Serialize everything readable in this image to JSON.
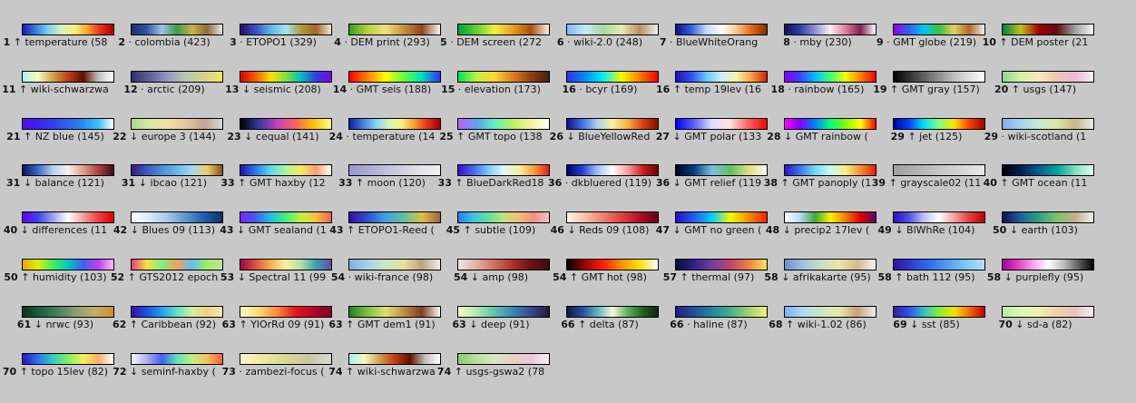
{
  "palettes": [
    {
      "rank": "1",
      "dir": "↑",
      "name": "temperature (58",
      "colors": [
        "#1a1ab0",
        "#3b7bd8",
        "#7ed0f0",
        "#d8f0c0",
        "#f8f080",
        "#f8a030",
        "#e83020",
        "#a00000"
      ]
    },
    {
      "rank": "2",
      "dir": "·",
      "name": "colombia (423)",
      "colors": [
        "#1d2d6b",
        "#2f57a5",
        "#9fc3e7",
        "#3c9a4a",
        "#c8b24a",
        "#8b6a3a",
        "#e8e8e8"
      ]
    },
    {
      "rank": "3",
      "dir": "·",
      "name": "ETOPO1 (329)",
      "colors": [
        "#2a0a6b",
        "#3c4fc4",
        "#5fb6e6",
        "#a6e3f2",
        "#b09a3c",
        "#a06628",
        "#f0e8d8"
      ]
    },
    {
      "rank": "4",
      "dir": "·",
      "name": "DEM print (293)",
      "colors": [
        "#34a020",
        "#b8d040",
        "#f0e080",
        "#c89040",
        "#904818",
        "#f8f8f8"
      ]
    },
    {
      "rank": "5",
      "dir": "·",
      "name": "DEM screen (272",
      "colors": [
        "#00a040",
        "#60d030",
        "#f0f040",
        "#e8a020",
        "#a85010",
        "#f8f0f0"
      ]
    },
    {
      "rank": "6",
      "dir": "·",
      "name": "wiki-2.0 (248)",
      "colors": [
        "#80b8f0",
        "#c8e8f8",
        "#a8d8a0",
        "#e8e8b0",
        "#b89060",
        "#f0f0f0"
      ]
    },
    {
      "rank": "7",
      "dir": "·",
      "name": "BlueWhiteOrang",
      "colors": [
        "#101080",
        "#3060e0",
        "#c0d8f8",
        "#ffffff",
        "#f8c890",
        "#e86818",
        "#803000"
      ]
    },
    {
      "rank": "8",
      "dir": "·",
      "name": "mby (230)",
      "colors": [
        "#101060",
        "#3040a0",
        "#9090d8",
        "#f8f0f0",
        "#e080a0",
        "#802050",
        "#ffffff"
      ]
    },
    {
      "rank": "9",
      "dir": "·",
      "name": "GMT globe (219)",
      "colors": [
        "#9000e0",
        "#3060f0",
        "#00c8f0",
        "#40c040",
        "#e0d060",
        "#b06830",
        "#f0f0f0"
      ]
    },
    {
      "rank": "10",
      "dir": "↑",
      "name": "DEM poster (21",
      "colors": [
        "#008040",
        "#c0c020",
        "#a00000",
        "#601010",
        "#a0a0a0",
        "#f8f8f8"
      ]
    },
    {
      "rank": "11",
      "dir": "↑",
      "name": "wiki-schwarzwa",
      "colors": [
        "#a8f0f0",
        "#f8f8c0",
        "#d0a050",
        "#c04010",
        "#601000",
        "#c0c0c0",
        "#ffffff"
      ]
    },
    {
      "rank": "12",
      "dir": "·",
      "name": "arctic (209)",
      "colors": [
        "#303070",
        "#606098",
        "#9898c0",
        "#b8c8b0",
        "#d8d090",
        "#f0e860"
      ]
    },
    {
      "rank": "13",
      "dir": "↓",
      "name": "seismic (208)",
      "colors": [
        "#e00000",
        "#f06000",
        "#f8e000",
        "#80e040",
        "#00c0c0",
        "#3040e0",
        "#8000f0"
      ]
    },
    {
      "rank": "14",
      "dir": "·",
      "name": "GMT seis (188)",
      "colors": [
        "#ff0000",
        "#ff8000",
        "#ffff00",
        "#60ff40",
        "#00e0c0",
        "#3030ff"
      ]
    },
    {
      "rank": "15",
      "dir": "·",
      "name": "elevation (173)",
      "colors": [
        "#00e060",
        "#c0f040",
        "#f8d830",
        "#e08020",
        "#904010",
        "#402010"
      ]
    },
    {
      "rank": "16",
      "dir": "·",
      "name": "bcyr (169)",
      "colors": [
        "#3030f0",
        "#0090f8",
        "#00f0f8",
        "#f8f800",
        "#f88000",
        "#f00000"
      ]
    },
    {
      "rank": "16",
      "dir": "↑",
      "name": "temp 19lev (16",
      "colors": [
        "#2010c0",
        "#3050f0",
        "#60c8f8",
        "#c8f0f8",
        "#f8f0b0",
        "#f8a040",
        "#d02010"
      ]
    },
    {
      "rank": "18",
      "dir": "·",
      "name": "rainbow (165)",
      "colors": [
        "#8000ff",
        "#4040ff",
        "#00c0ff",
        "#40ff80",
        "#f0ff00",
        "#ff8000",
        "#ff0000"
      ]
    },
    {
      "rank": "19",
      "dir": "↑",
      "name": "GMT gray (157)",
      "colors": [
        "#000000",
        "#606060",
        "#c0c0c0",
        "#ffffff"
      ]
    },
    {
      "rank": "20",
      "dir": "↑",
      "name": "usgs (147)",
      "colors": [
        "#88d890",
        "#d8f0a8",
        "#f8e8c0",
        "#e8c8b0",
        "#e8b8d8",
        "#f8f0f8"
      ]
    },
    {
      "rank": "21",
      "dir": "↑",
      "name": "NZ blue (145)",
      "colors": [
        "#5010f0",
        "#4020f0",
        "#3040f0",
        "#3060f0",
        "#2090f0",
        "#40c0f8",
        "#ffffff"
      ]
    },
    {
      "rank": "22",
      "dir": "↓",
      "name": "europe 3 (144)",
      "colors": [
        "#a8d890",
        "#d8e8a0",
        "#f0e0a8",
        "#e0c8a0",
        "#c8a090",
        "#d8d8d8"
      ]
    },
    {
      "rank": "23",
      "dir": "↓",
      "name": "cequal (141)",
      "colors": [
        "#000000",
        "#3838a0",
        "#c040c0",
        "#ff6060",
        "#ffc000",
        "#ffff80"
      ]
    },
    {
      "rank": "24",
      "dir": "·",
      "name": "temperature (14",
      "colors": [
        "#1a1ab0",
        "#3b7bd8",
        "#7ed0f0",
        "#d8f0c0",
        "#f8f080",
        "#f8a030",
        "#e83020",
        "#a00000"
      ]
    },
    {
      "rank": "25",
      "dir": "↑",
      "name": "GMT topo (138",
      "colors": [
        "#c060f0",
        "#60a0f0",
        "#60f0c0",
        "#c0f060",
        "#f8f0a0",
        "#ffffff"
      ]
    },
    {
      "rank": "26",
      "dir": "↓",
      "name": "BlueYellowRed",
      "colors": [
        "#101090",
        "#4070e0",
        "#b0d0f0",
        "#f8f0a0",
        "#f8b040",
        "#e04010",
        "#801000"
      ]
    },
    {
      "rank": "27",
      "dir": "↓",
      "name": "GMT polar (133",
      "colors": [
        "#0000ff",
        "#6060ff",
        "#e0e0ff",
        "#ffe0e0",
        "#ff6060",
        "#ff0000"
      ]
    },
    {
      "rank": "28",
      "dir": "↓",
      "name": "GMT rainbow (",
      "colors": [
        "#ff00ff",
        "#8000ff",
        "#0080ff",
        "#00ff80",
        "#80ff00",
        "#ffff00",
        "#ff0000"
      ]
    },
    {
      "rank": "29",
      "dir": "↑",
      "name": "jet (125)",
      "colors": [
        "#0000a0",
        "#0040ff",
        "#00e0ff",
        "#80ff80",
        "#ffe000",
        "#ff4000",
        "#a00000"
      ]
    },
    {
      "rank": "29",
      "dir": "·",
      "name": "wiki-scotland (1",
      "colors": [
        "#80b0e8",
        "#a8d0f0",
        "#c8e8d0",
        "#d8e8a8",
        "#c8b888",
        "#e8e8e8"
      ]
    },
    {
      "rank": "31",
      "dir": "↓",
      "name": "balance (121)",
      "colors": [
        "#101060",
        "#3868c8",
        "#b8d0f0",
        "#f8f0f0",
        "#e0a090",
        "#b04040",
        "#400818"
      ]
    },
    {
      "rank": "31",
      "dir": "↓",
      "name": "ibcao (121)",
      "colors": [
        "#381880",
        "#3858c0",
        "#4890d8",
        "#68b8e8",
        "#a8d8f0",
        "#f0d060",
        "#8a5020"
      ]
    },
    {
      "rank": "33",
      "dir": "↑",
      "name": "GMT haxby (12",
      "colors": [
        "#2810a8",
        "#2878f0",
        "#60d8f0",
        "#a8f8a0",
        "#f8e860",
        "#f8a070",
        "#ffffff"
      ]
    },
    {
      "rank": "33",
      "dir": "↑",
      "name": "moon (120)",
      "colors": [
        "#9898d0",
        "#b0b0d8",
        "#c8c8e0",
        "#e0e0e8",
        "#f0f0f0"
      ]
    },
    {
      "rank": "33",
      "dir": "↑",
      "name": "BlueDarkRed18",
      "colors": [
        "#3810d0",
        "#4068f0",
        "#80c8f8",
        "#d8f8f8",
        "#f8f0a0",
        "#f8a040",
        "#e02010"
      ]
    },
    {
      "rank": "36",
      "dir": "·",
      "name": "dkbluered (119)",
      "colors": [
        "#000070",
        "#2040d0",
        "#a0c0f8",
        "#ffffff",
        "#f8a0a0",
        "#d02020",
        "#700000"
      ]
    },
    {
      "rank": "36",
      "dir": "↓",
      "name": "GMT relief (119",
      "colors": [
        "#000020",
        "#004080",
        "#80c0e0",
        "#60c060",
        "#e0e080",
        "#f8f8f8"
      ]
    },
    {
      "rank": "38",
      "dir": "↑",
      "name": "GMT panoply (1",
      "colors": [
        "#3010c0",
        "#3878f0",
        "#70d8f8",
        "#c8f8f8",
        "#f8f080",
        "#f89030",
        "#e02010"
      ]
    },
    {
      "rank": "39",
      "dir": "↑",
      "name": "grayscale02 (11",
      "colors": [
        "#a0a0a0",
        "#b8b8b8",
        "#d0d0d0",
        "#e8e8e8"
      ]
    },
    {
      "rank": "40",
      "dir": "↑",
      "name": "GMT ocean (11",
      "colors": [
        "#000000",
        "#002050",
        "#006090",
        "#00a0a0",
        "#80e0c0",
        "#e0fff8"
      ]
    },
    {
      "rank": "40",
      "dir": "↓",
      "name": "differences (11",
      "colors": [
        "#6000f0",
        "#4040f0",
        "#a0a0f8",
        "#ffffff",
        "#f8a0a0",
        "#f04040",
        "#e00000"
      ]
    },
    {
      "rank": "42",
      "dir": "↓",
      "name": "Blues 09 (113)",
      "colors": [
        "#ffffff",
        "#d8e8f8",
        "#a0c8e8",
        "#5898d0",
        "#2060b0",
        "#08306b"
      ]
    },
    {
      "rank": "43",
      "dir": "↓",
      "name": "GMT sealand (1",
      "colors": [
        "#8020f0",
        "#4060f0",
        "#20c0e0",
        "#40f080",
        "#c0f040",
        "#f8c040",
        "#f06060"
      ]
    },
    {
      "rank": "43",
      "dir": "↑",
      "name": "ETOPO1-Reed (",
      "colors": [
        "#3010a0",
        "#3050d0",
        "#40a0e0",
        "#60c0a0",
        "#e0c040",
        "#a06040"
      ]
    },
    {
      "rank": "45",
      "dir": "↑",
      "name": "subtle (109)",
      "colors": [
        "#2080f0",
        "#40c0e0",
        "#60e0a0",
        "#c0e080",
        "#f0c070",
        "#f09080",
        "#f8c0d0"
      ]
    },
    {
      "rank": "46",
      "dir": "↓",
      "name": "Reds 09 (108)",
      "colors": [
        "#fff0e8",
        "#f8c0a8",
        "#f08070",
        "#e04040",
        "#b01020",
        "#670010"
      ]
    },
    {
      "rank": "47",
      "dir": "↓",
      "name": "GMT no green (",
      "colors": [
        "#2010c0",
        "#2060f0",
        "#00d0f8",
        "#f8f800",
        "#f89000",
        "#f02000"
      ]
    },
    {
      "rank": "48",
      "dir": "↓",
      "name": "precip2 17lev (",
      "colors": [
        "#ffffff",
        "#b8d8f8",
        "#40a840",
        "#f8f000",
        "#f08000",
        "#e00000",
        "#600060"
      ]
    },
    {
      "rank": "49",
      "dir": "↓",
      "name": "BlWhRe (104)",
      "colors": [
        "#3010c0",
        "#5050e0",
        "#c0c0f8",
        "#ffffff",
        "#f8a0a0",
        "#e04040",
        "#c00000"
      ]
    },
    {
      "rank": "50",
      "dir": "↓",
      "name": "earth (103)",
      "colors": [
        "#101050",
        "#2060a0",
        "#30a080",
        "#80c070",
        "#c0b088",
        "#f0f0f0"
      ]
    },
    {
      "rank": "50",
      "dir": "↑",
      "name": "humidity (103)",
      "colors": [
        "#f0a000",
        "#e0f000",
        "#40f060",
        "#00c8c0",
        "#4060f0",
        "#c040f0",
        "#f8c0f8"
      ]
    },
    {
      "rank": "52",
      "dir": "↑",
      "name": "GTS2012 epoch",
      "colors": [
        "#e04080",
        "#f8e040",
        "#80f080",
        "#f0a060",
        "#60c0f0",
        "#a0f060",
        "#c0e0a0"
      ]
    },
    {
      "rank": "53",
      "dir": "↓",
      "name": "Spectral 11 (99",
      "colors": [
        "#9e0142",
        "#e05040",
        "#f8b050",
        "#fff0a0",
        "#b0e0a0",
        "#40a0b0",
        "#5e4fa2"
      ]
    },
    {
      "rank": "54",
      "dir": "·",
      "name": "wiki-france (98)",
      "colors": [
        "#80b0e0",
        "#a8d0f0",
        "#c8e8c0",
        "#e8e0a0",
        "#c0a080",
        "#f0f0f0"
      ]
    },
    {
      "rank": "54",
      "dir": "↓",
      "name": "amp (98)",
      "colors": [
        "#f0e8e8",
        "#e0b0a0",
        "#d07060",
        "#b03030",
        "#701010",
        "#3c0910"
      ]
    },
    {
      "rank": "54",
      "dir": "↑",
      "name": "GMT hot (98)",
      "colors": [
        "#000000",
        "#a00000",
        "#ff2000",
        "#ff9000",
        "#ffe000",
        "#ffffff"
      ]
    },
    {
      "rank": "57",
      "dir": "↑",
      "name": "thermal (97)",
      "colors": [
        "#041030",
        "#30208a",
        "#7040a0",
        "#c04070",
        "#f08040",
        "#f8e060"
      ]
    },
    {
      "rank": "58",
      "dir": "↓",
      "name": "afrikakarte (95)",
      "colors": [
        "#7090c8",
        "#a0c0e0",
        "#c8e0c0",
        "#e8e8a8",
        "#d0b890",
        "#f8f8f8"
      ]
    },
    {
      "rank": "58",
      "dir": "↑",
      "name": "bath 112 (95)",
      "colors": [
        "#3010a0",
        "#3040d0",
        "#3070f0",
        "#50a0f0",
        "#80c8f8",
        "#b0e0f8"
      ]
    },
    {
      "rank": "58",
      "dir": "↓",
      "name": "purplefly (95)",
      "colors": [
        "#a000a0",
        "#e040c0",
        "#f8a0f0",
        "#ffffff",
        "#c0c0c0",
        "#606060",
        "#000000"
      ]
    },
    {
      "rank": "61",
      "dir": "↓",
      "name": "nrwc (93)",
      "colors": [
        "#103020",
        "#206040",
        "#508060",
        "#90a070",
        "#c0b060",
        "#d09030"
      ]
    },
    {
      "rank": "62",
      "dir": "↑",
      "name": "Caribbean (92)",
      "colors": [
        "#3010a0",
        "#2050e0",
        "#20a0f0",
        "#60e0c0",
        "#d0f0a0",
        "#f0d080",
        "#f8e8c0"
      ]
    },
    {
      "rank": "63",
      "dir": "↑",
      "name": "YlOrRd 09 (91)",
      "colors": [
        "#ffffcc",
        "#fed976",
        "#fd8d3c",
        "#e31a1c",
        "#bd0026",
        "#800026"
      ]
    },
    {
      "rank": "63",
      "dir": "↑",
      "name": "GMT dem1 (91)",
      "colors": [
        "#208020",
        "#80c040",
        "#e0e070",
        "#c09040",
        "#804020",
        "#f8f8f8"
      ]
    },
    {
      "rank": "63",
      "dir": "↓",
      "name": "deep (91)",
      "colors": [
        "#f8fcc8",
        "#b0e8b0",
        "#60c0b0",
        "#3888b0",
        "#3a4890",
        "#281838"
      ]
    },
    {
      "rank": "66",
      "dir": "↑",
      "name": "delta (87)",
      "colors": [
        "#101840",
        "#2050a0",
        "#60b0c0",
        "#f8f8d8",
        "#60b060",
        "#206020",
        "#102810"
      ]
    },
    {
      "rank": "66",
      "dir": "·",
      "name": "haline (87)",
      "colors": [
        "#2a1880",
        "#2050a0",
        "#2088a0",
        "#40b090",
        "#a0d070",
        "#f8f080"
      ]
    },
    {
      "rank": "68",
      "dir": "↑",
      "name": "wiki-1.02 (86)",
      "colors": [
        "#80b0f0",
        "#b0d8f8",
        "#c8e8c0",
        "#e8e8b0",
        "#c8a078",
        "#f0f0f0"
      ]
    },
    {
      "rank": "69",
      "dir": "↓",
      "name": "sst (85)",
      "colors": [
        "#302090",
        "#3050f0",
        "#30c0c0",
        "#80f040",
        "#f8e000",
        "#f07000",
        "#c00000"
      ]
    },
    {
      "rank": "70",
      "dir": "↓",
      "name": "sd-a (82)",
      "colors": [
        "#b8f0a8",
        "#d8f8b0",
        "#f0f0b0",
        "#f0d0a8",
        "#e8c0c0",
        "#f8f0f8"
      ]
    },
    {
      "rank": "70",
      "dir": "↑",
      "name": "topo 15lev (82)",
      "colors": [
        "#3010c0",
        "#3070f0",
        "#30d0c0",
        "#80f060",
        "#f0f060",
        "#f8b060",
        "#ffffff"
      ]
    },
    {
      "rank": "72",
      "dir": "↓",
      "name": "seminf-haxby (",
      "colors": [
        "#f8f8f8",
        "#b0b0f0",
        "#4060f0",
        "#60e0c0",
        "#c0f080",
        "#f8c060",
        "#f06040"
      ]
    },
    {
      "rank": "73",
      "dir": "·",
      "name": "zambezi-focus (",
      "colors": [
        "#f8f8d0",
        "#f0e8a0",
        "#d8d890",
        "#c8c8a0",
        "#d8d8d8"
      ]
    },
    {
      "rank": "74",
      "dir": "↑",
      "name": "wiki-schwarzwa",
      "colors": [
        "#a8f0f0",
        "#f8f8c0",
        "#d0a050",
        "#c04010",
        "#601000",
        "#c0c0c0",
        "#ffffff"
      ]
    },
    {
      "rank": "74",
      "dir": "↑",
      "name": "usgs-gswa2 (78",
      "colors": [
        "#88c870",
        "#b8e0a0",
        "#d8e8c0",
        "#e8d0c0",
        "#e8c8d8",
        "#f8f0f8"
      ]
    }
  ]
}
